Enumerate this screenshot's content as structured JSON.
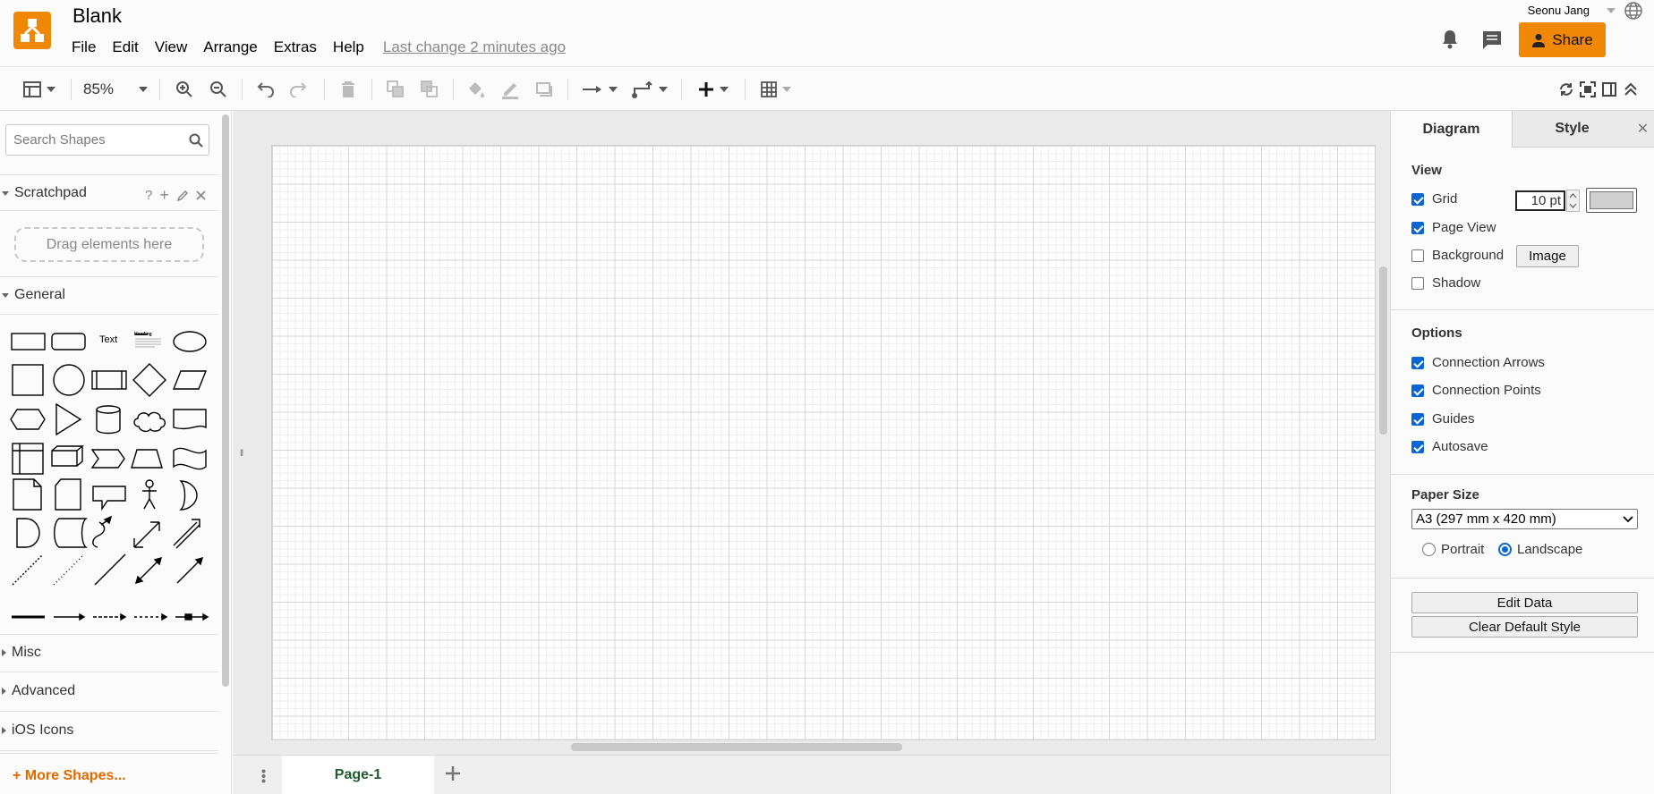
{
  "app": {
    "title": "Blank",
    "last_change": "Last change 2 minutes ago",
    "user": "Seonu Jang",
    "share_label": "Share",
    "brand_color": "#f08705"
  },
  "menu": [
    "File",
    "Edit",
    "View",
    "Arrange",
    "Extras",
    "Help"
  ],
  "toolbar": {
    "zoom": "85%",
    "icons": [
      "format-panel-icon",
      "zoom-in-icon",
      "zoom-out-icon",
      "undo-icon",
      "redo-icon",
      "delete-icon",
      "to-front-icon",
      "to-back-icon",
      "fill-color-icon",
      "line-color-icon",
      "shadow-icon",
      "connection-icon",
      "waypoints-icon",
      "insert-icon",
      "table-icon",
      "refresh-icon",
      "fit-icon",
      "panel-toggle-icon",
      "collapse-icon"
    ]
  },
  "sidebar": {
    "search_placeholder": "Search Shapes",
    "scratchpad": {
      "title": "Scratchpad",
      "drop_hint": "Drag elements here",
      "help": "?"
    },
    "general_title": "General",
    "text_shape": "Text",
    "heading_shape": "Heading",
    "sections": [
      "Misc",
      "Advanced",
      "iOS Icons"
    ],
    "more_shapes": "+ More Shapes..."
  },
  "pages": {
    "tabs": [
      "Page-1"
    ]
  },
  "panel": {
    "tabs": [
      "Diagram",
      "Style"
    ],
    "view": {
      "title": "View",
      "grid": {
        "label": "Grid",
        "checked": true,
        "size": "10 pt"
      },
      "page_view": {
        "label": "Page View",
        "checked": true
      },
      "background": {
        "label": "Background",
        "checked": false,
        "button": "Image"
      },
      "shadow": {
        "label": "Shadow",
        "checked": false
      }
    },
    "options": {
      "title": "Options",
      "items": [
        {
          "label": "Connection Arrows",
          "checked": true
        },
        {
          "label": "Connection Points",
          "checked": true
        },
        {
          "label": "Guides",
          "checked": true
        },
        {
          "label": "Autosave",
          "checked": true
        }
      ]
    },
    "paper": {
      "title": "Paper Size",
      "size": "A3 (297 mm x 420 mm)",
      "portrait": "Portrait",
      "landscape": "Landscape",
      "orientation": "Landscape"
    },
    "buttons": {
      "edit_data": "Edit Data",
      "clear_style": "Clear Default Style"
    }
  }
}
